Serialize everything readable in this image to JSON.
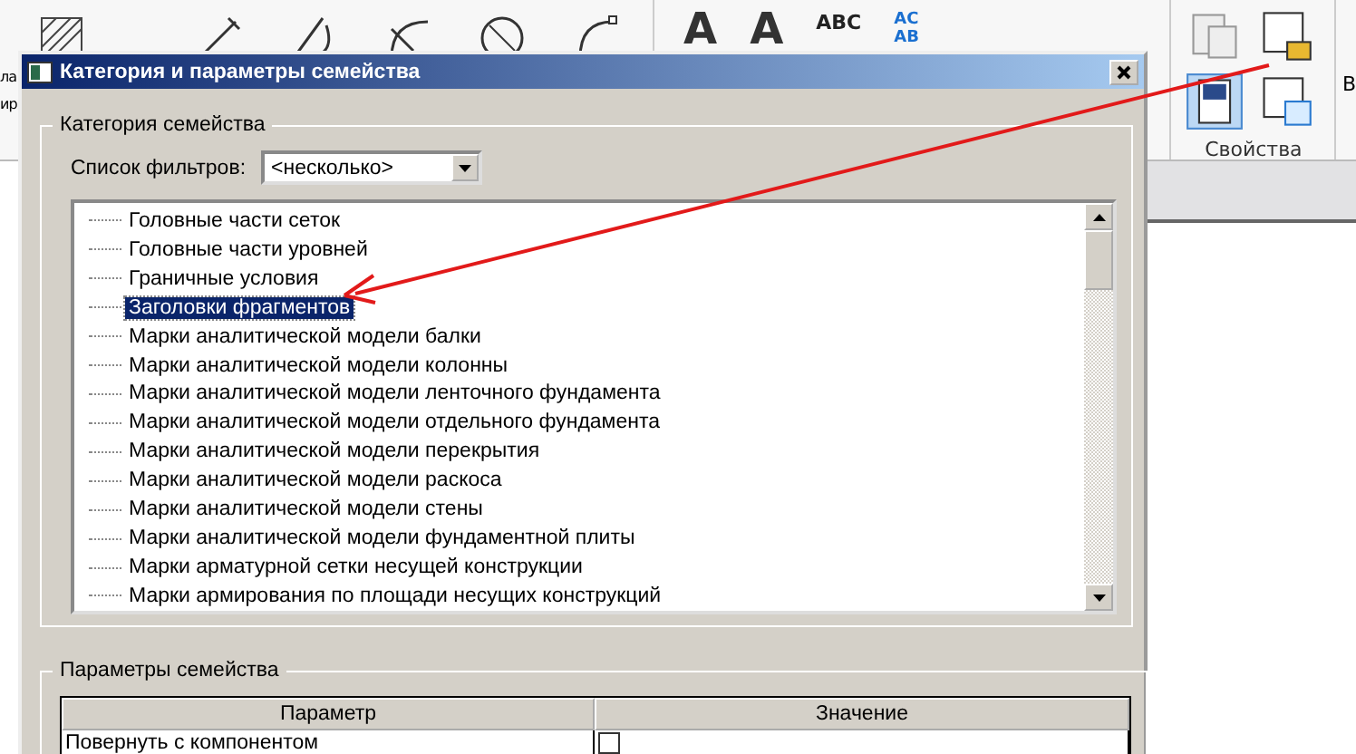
{
  "ribbon": {
    "left_cut_labels": [
      "ла",
      "ир"
    ],
    "text_tools": [
      {
        "kind": "big-letter",
        "label": "A"
      },
      {
        "kind": "big-letter",
        "label": "A"
      },
      {
        "kind": "spell",
        "label": "ABC"
      },
      {
        "kind": "find",
        "label": "AC",
        "label_2": "AB"
      }
    ],
    "panel_title": "Свойства",
    "right_cut_label": "В"
  },
  "dialog": {
    "title": "Категория и параметры семейства",
    "category_group": {
      "title": "Категория семейства",
      "filter_label": "Список фильтров:",
      "filter_value": "<несколько>",
      "items": [
        {
          "label": "Головные части сеток",
          "selected": false
        },
        {
          "label": "Головные части уровней",
          "selected": false
        },
        {
          "label": "Граничные условия",
          "selected": false
        },
        {
          "label": "Заголовки фрагментов",
          "selected": true
        },
        {
          "label": "Марки аналитической модели балки",
          "selected": false
        },
        {
          "label": "Марки аналитической модели колонны",
          "selected": false
        },
        {
          "label": "Марки аналитической модели ленточного фундамента",
          "selected": false
        },
        {
          "label": "Марки аналитической модели отдельного фундамента",
          "selected": false
        },
        {
          "label": "Марки аналитической модели перекрытия",
          "selected": false
        },
        {
          "label": "Марки аналитической модели раскоса",
          "selected": false
        },
        {
          "label": "Марки аналитической модели стены",
          "selected": false
        },
        {
          "label": "Марки аналитической модели фундаментной плиты",
          "selected": false
        },
        {
          "label": "Марки арматурной сетки несущей конструкции",
          "selected": false
        },
        {
          "label": "Марки армирования по площади несущих конструкций",
          "selected": false
        }
      ]
    },
    "parameters_group": {
      "title": "Параметры семейства",
      "columns": [
        "Параметр",
        "Значение"
      ],
      "rows": [
        {
          "name": "Повернуть с компонентом",
          "checked": false
        }
      ]
    }
  }
}
